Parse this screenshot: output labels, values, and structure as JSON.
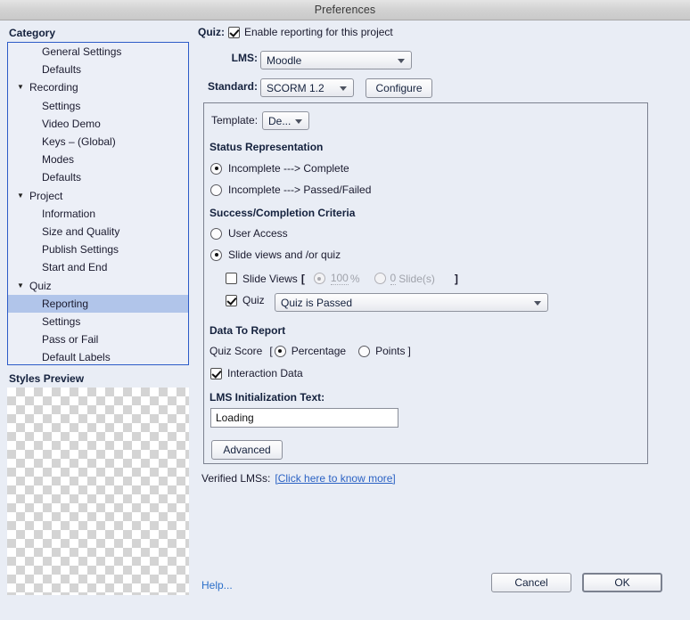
{
  "window": {
    "title": "Preferences"
  },
  "sidebar": {
    "heading": "Category",
    "items": [
      {
        "label": "General Settings",
        "level": 2,
        "twisty": "",
        "selected": false
      },
      {
        "label": "Defaults",
        "level": 2,
        "twisty": "",
        "selected": false
      },
      {
        "label": "Recording",
        "level": 1,
        "twisty": "▼",
        "selected": false
      },
      {
        "label": "Settings",
        "level": 2,
        "twisty": "",
        "selected": false
      },
      {
        "label": "Video Demo",
        "level": 2,
        "twisty": "",
        "selected": false
      },
      {
        "label": "Keys – (Global)",
        "level": 2,
        "twisty": "",
        "selected": false
      },
      {
        "label": "Modes",
        "level": 2,
        "twisty": "",
        "selected": false
      },
      {
        "label": "Defaults",
        "level": 2,
        "twisty": "",
        "selected": false
      },
      {
        "label": "Project",
        "level": 1,
        "twisty": "▼",
        "selected": false
      },
      {
        "label": "Information",
        "level": 2,
        "twisty": "",
        "selected": false
      },
      {
        "label": "Size and Quality",
        "level": 2,
        "twisty": "",
        "selected": false
      },
      {
        "label": "Publish Settings",
        "level": 2,
        "twisty": "",
        "selected": false
      },
      {
        "label": "Start and End",
        "level": 2,
        "twisty": "",
        "selected": false
      },
      {
        "label": "Quiz",
        "level": 1,
        "twisty": "▼",
        "selected": false
      },
      {
        "label": "Reporting",
        "level": 2,
        "twisty": "",
        "selected": true
      },
      {
        "label": "Settings",
        "level": 2,
        "twisty": "",
        "selected": false
      },
      {
        "label": "Pass or Fail",
        "level": 2,
        "twisty": "",
        "selected": false
      },
      {
        "label": "Default Labels",
        "level": 2,
        "twisty": "",
        "selected": false
      }
    ],
    "styles_preview_heading": "Styles Preview"
  },
  "main": {
    "quiz_label": "Quiz:",
    "enable_reporting_label": "Enable reporting for this project",
    "enable_reporting_checked": true,
    "lms_label": "LMS:",
    "lms_value": "Moodle",
    "standard_label": "Standard:",
    "standard_value": "SCORM 1.2",
    "configure_button": "Configure",
    "group": {
      "template_label": "Template:",
      "template_value": "De...",
      "status_heading": "Status Representation",
      "status_option_1": "Incomplete ---> Complete",
      "status_option_2": "Incomplete ---> Passed/Failed",
      "status_selected": 1,
      "criteria_heading": "Success/Completion Criteria",
      "criteria_option_1": "User Access",
      "criteria_option_2": "Slide views and /or quiz",
      "criteria_selected": 2,
      "slide_views_label": "Slide Views",
      "slide_views_checked": false,
      "bracket_open": "[",
      "bracket_close": "]",
      "percentage_radio_label": "%",
      "percentage_value": "100",
      "slides_radio_label": "Slide(s)",
      "slides_value": "0",
      "slide_measure_selected": "percentage",
      "quiz_checkbox_label": "Quiz",
      "quiz_checkbox_checked": true,
      "quiz_condition_value": "Quiz is Passed",
      "data_heading": "Data To Report",
      "quiz_score_label": "Quiz Score",
      "score_bracket_open": "[",
      "score_bracket_close": "]",
      "score_option_1": "Percentage",
      "score_option_2": "Points",
      "score_selected": 1,
      "interaction_data_label": "Interaction Data",
      "interaction_data_checked": true,
      "lms_init_label": "LMS Initialization Text:",
      "lms_init_value": "Loading",
      "advanced_button": "Advanced"
    },
    "verified_lms_label": "Verified LMSs:",
    "verified_lms_link": "[Click here to know more]"
  },
  "footer": {
    "help_label": "Help...",
    "cancel_label": "Cancel",
    "ok_label": "OK"
  },
  "colors": {
    "window_bg": "#e9edf5",
    "tree_border": "#2c5bc8",
    "selection": "#b1c5ea",
    "link": "#2b62c4",
    "group_border": "#7c8190"
  }
}
